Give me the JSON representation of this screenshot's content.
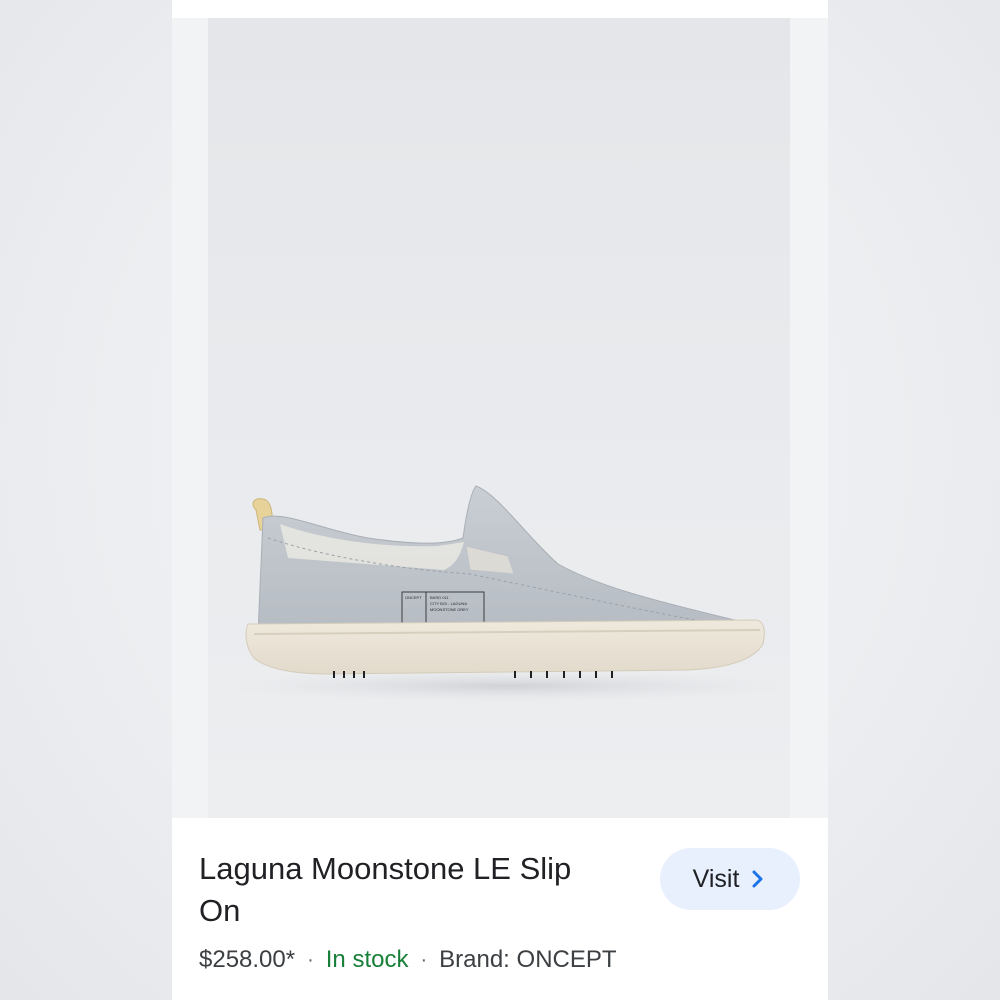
{
  "product": {
    "title": "Laguna Moonstone LE Slip On",
    "price": "$258.00*",
    "availability": "In stock",
    "brand": "Brand: ONCEPT",
    "image_alt": "Light grey leather slip-on sneaker with off-white rubber sole",
    "shoe_label": {
      "brand": "ONCEPT",
      "line1": "BKRD 011",
      "line2": "CITY BOI - LAGUNA",
      "line3": "MOONSTONE GREY"
    }
  },
  "actions": {
    "visit_label": "Visit",
    "visit_icon": "chevron-right-icon"
  },
  "colors": {
    "accent_button_bg": "#e8f0fe",
    "accent_chevron": "#1a73e8",
    "in_stock": "#188038"
  }
}
